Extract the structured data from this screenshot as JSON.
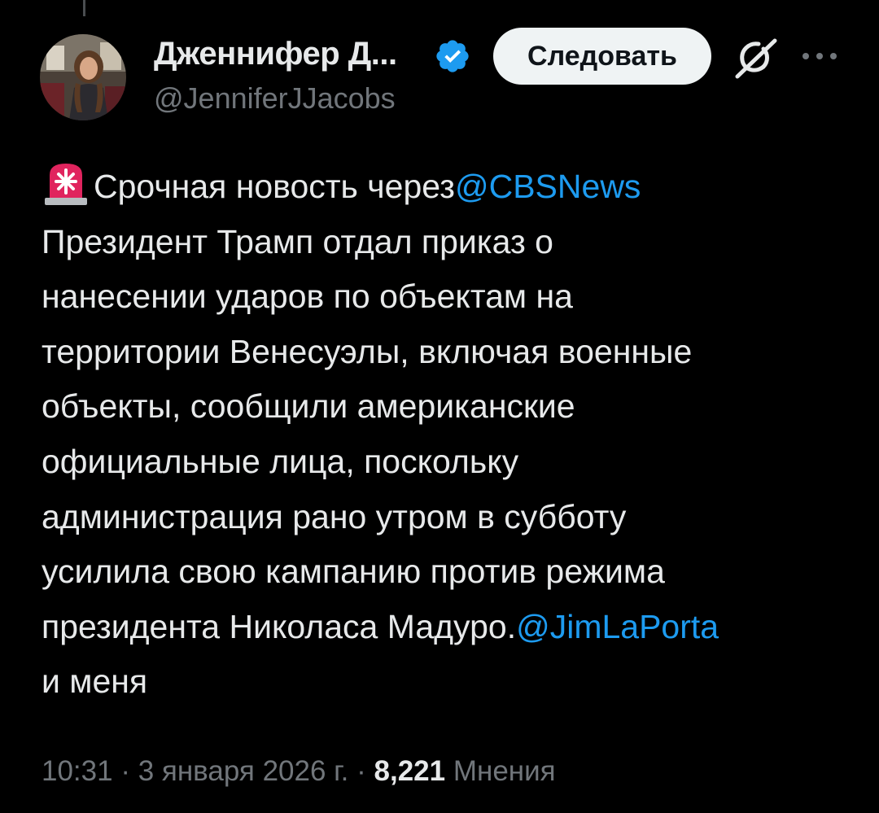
{
  "author": {
    "display_name": "Дженнифер Д...",
    "handle": "@JenniferJJacobs",
    "verified_icon": "verified-badge-icon",
    "avatar_icon": "avatar"
  },
  "actions": {
    "follow_label": "Следовать",
    "grok_icon": "grok-icon",
    "more_icon": "more-options-icon"
  },
  "tweet": {
    "line1_prefix": "Срочная новость через",
    "line1_mention": "@CBSNews",
    "line2": "Президент Трамп отдал приказ о",
    "line3": "нанесении ударов по объектам на",
    "line4": "территории Венесуэлы, включая военные",
    "line5": "объекты, сообщили американские",
    "line6": "официальные лица, поскольку",
    "line7": "администрация рано утром в субботу",
    "line8": "усилила свою кампанию против режима",
    "line9_prefix": "президента Николаса Мадуро.",
    "line9_mention": "@JimLaPorta",
    "line10": "и меня"
  },
  "meta": {
    "time": "10:31",
    "sep1": " · ",
    "date": "3 января 2026 г.",
    "sep2": " · ",
    "views_count": "8,221",
    "views_label": " Мнения"
  },
  "colors": {
    "background": "#000000",
    "text": "#e7e9ea",
    "secondary": "#71767b",
    "accent": "#1d9bf0",
    "siren": "#e0245e"
  }
}
